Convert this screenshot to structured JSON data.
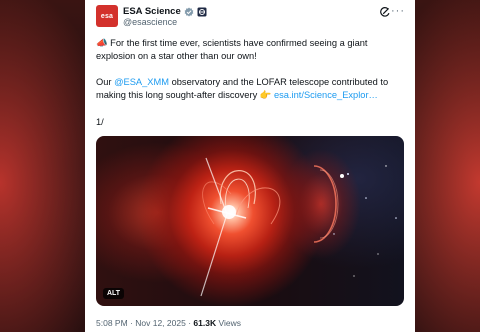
{
  "account": {
    "avatar_text": "esa",
    "display_name": "ESA Science",
    "handle": "@esascience",
    "brand_color": "#d3312c",
    "verified_icon": "verified-gray-badge-icon",
    "affiliation_icon": "esa-affiliation-icon"
  },
  "toolbar": {
    "grok_icon": "grok-icon",
    "more_label": "···"
  },
  "tweet": {
    "para1_emoji": "📣",
    "para1": "For the first time ever, scientists have confirmed seeing a giant explosion on a star other than our own!",
    "para2_prefix": "Our ",
    "mention": "@ESA_XMM",
    "para2_middle": " observatory and the LOFAR telescope contributed to making this long sought-after discovery ",
    "para2_emoji": "👉",
    "link": "esa.int/Science_Explor…",
    "thread_marker": "1/"
  },
  "media": {
    "alt_label": "ALT"
  },
  "meta": {
    "time": "5:08 PM",
    "date": "Nov 12, 2025",
    "views_count": "61.3K",
    "views_label": "Views"
  },
  "colors": {
    "text": "#0f1419",
    "secondary": "#536471",
    "link": "#1d9bf0"
  }
}
